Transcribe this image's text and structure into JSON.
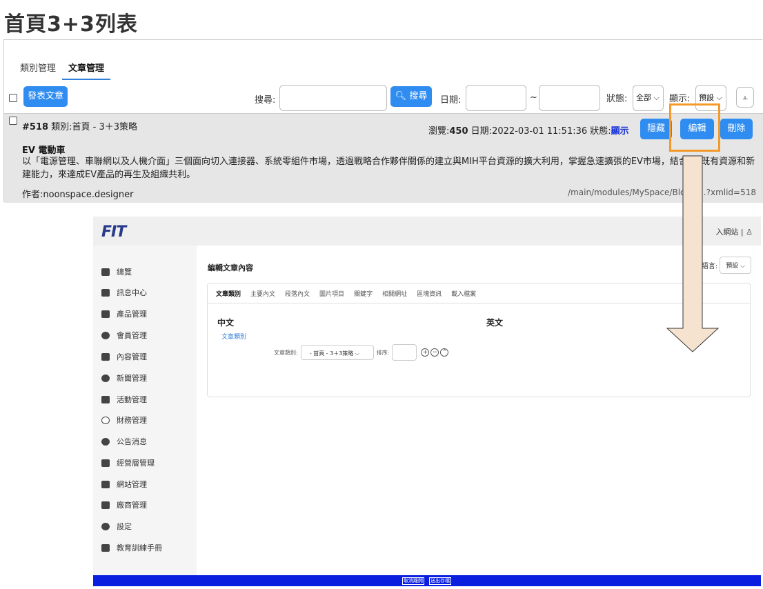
{
  "page": {
    "title": "首頁3+3列表"
  },
  "tabs": [
    {
      "label": "類別管理"
    },
    {
      "label": "文章管理"
    }
  ],
  "toolbar": {
    "post_button": "發表文章",
    "search_label": "搜尋:",
    "search_button": "搜尋",
    "date_label": "日期:",
    "date_sep": "~",
    "status_label": "狀態:",
    "status_value": "全部",
    "display_label": "顯示:",
    "display_value": "預設"
  },
  "record": {
    "id": "#518",
    "category": "類別:首頁 - 3＋3策略",
    "views_label": "瀏覽:",
    "views": "450",
    "date_label": "日期:",
    "date": "2022-03-01 11:51:36",
    "status_label": "狀態:",
    "status": "顯示",
    "hide_button": "隱藏",
    "edit_button": "編輯",
    "delete_button": "刪除",
    "title": "EV 電動車",
    "description": "以「電源管理、車聯網以及人機介面」三個面向切入連接器、系統零組件市場，透過戰略合作夥伴關係的建立與MIH平台資源的擴大利用，掌握急速擴張的EV市場，結合FIT既有資源和新建能力，來達成EV產品的再生及組織共利。",
    "author": "作者:noonspace.designer",
    "url": "/main/modules/MySpace/BlogIn...?xmlid=518"
  },
  "colors": {
    "accent": "#2f8cf0",
    "highlight": "#f39a2b",
    "arrow_fill": "#f5e3cf",
    "footer": "#0a1ee0"
  },
  "embedded": {
    "logo": "FIT",
    "top_right": "入網站 | ",
    "sidebar": [
      {
        "label": "總覽",
        "icon": "home-icon"
      },
      {
        "label": "訊息中心",
        "icon": "message-icon"
      },
      {
        "label": "產品管理",
        "icon": "briefcase-icon"
      },
      {
        "label": "會員管理",
        "icon": "members-icon"
      },
      {
        "label": "內容管理",
        "icon": "document-icon"
      },
      {
        "label": "新聞管理",
        "icon": "globe-icon"
      },
      {
        "label": "活動管理",
        "icon": "check-icon"
      },
      {
        "label": "財務管理",
        "icon": "copyright-icon"
      },
      {
        "label": "公告消息",
        "icon": "info-icon"
      },
      {
        "label": "經營層管理",
        "icon": "panel-icon"
      },
      {
        "label": "網站管理",
        "icon": "store-icon"
      },
      {
        "label": "廠商管理",
        "icon": "archive-icon"
      },
      {
        "label": "設定",
        "icon": "gear-icon"
      },
      {
        "label": "教育訓練手冊",
        "icon": "manual-icon"
      }
    ],
    "main_title": "編輯文章內容",
    "lang_label": "語言:",
    "lang_value": "預設",
    "card_tabs": [
      "文章類別",
      "主要內文",
      "段落內文",
      "圖片項目",
      "關鍵字",
      "相關網址",
      "區塊資訊",
      "載入檔案"
    ],
    "zh": "中文",
    "en": "英文",
    "cat_link": "文章類別",
    "cat_label": "文章類別:",
    "cat_value": "- 首頁 - 3＋3策略",
    "sort_label": "排序:",
    "footer_buttons": [
      "取消離開",
      "送出存檔"
    ]
  }
}
